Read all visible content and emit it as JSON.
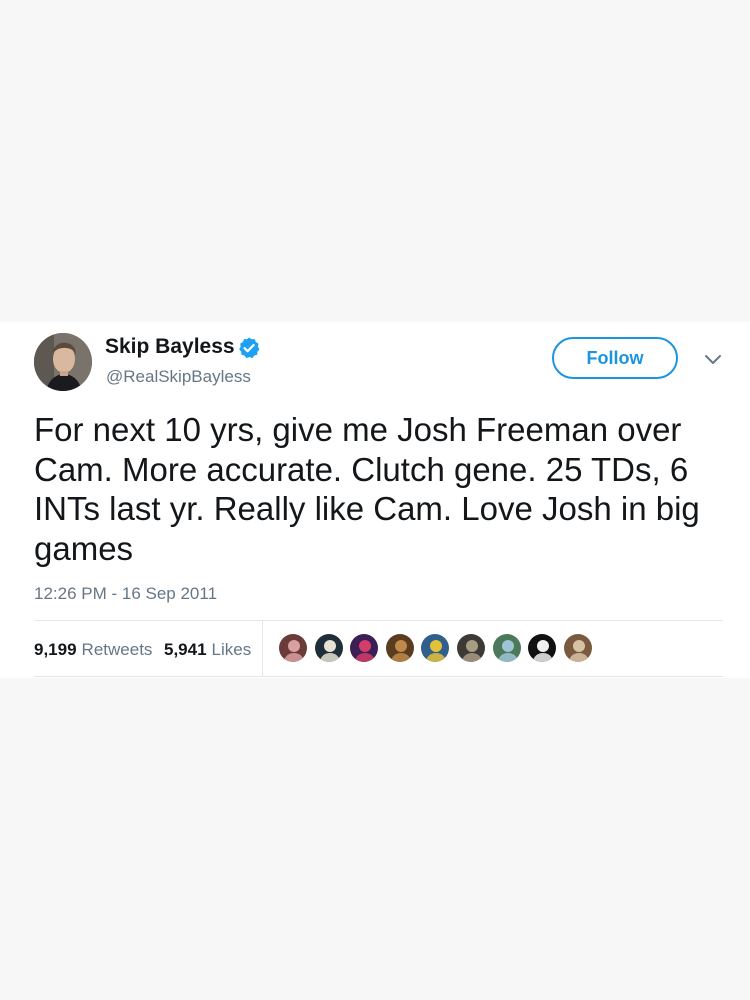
{
  "tweet": {
    "display_name": "Skip Bayless",
    "handle": "@RealSkipBayless",
    "verified": true,
    "follow_label": "Follow",
    "text": "For next 10 yrs, give me Josh Freeman over Cam. More accurate. Clutch gene. 25 TDs, 6 INTs last yr. Really like Cam. Love Josh in big games",
    "timestamp": "12:26 PM - 16 Sep 2011",
    "retweets": {
      "count": "9,199",
      "label": "Retweets"
    },
    "likes": {
      "count": "5,941",
      "label": "Likes"
    },
    "liker_avatars": [
      {
        "icon": "avatar-icon",
        "colors": [
          "#6b3b3b",
          "#d9a0a0"
        ]
      },
      {
        "icon": "avatar-icon",
        "colors": [
          "#1f2f3a",
          "#e8e2d5"
        ]
      },
      {
        "icon": "avatar-icon",
        "colors": [
          "#3b1f55",
          "#d23d6a"
        ]
      },
      {
        "icon": "avatar-icon",
        "colors": [
          "#5a3d1f",
          "#c08a4c"
        ]
      },
      {
        "icon": "avatar-icon",
        "colors": [
          "#2f5f8a",
          "#e3c23a"
        ]
      },
      {
        "icon": "avatar-icon",
        "colors": [
          "#3d3a35",
          "#a89c85"
        ]
      },
      {
        "icon": "avatar-icon",
        "colors": [
          "#4a7a5a",
          "#9fc4d6"
        ]
      },
      {
        "icon": "avatar-icon",
        "colors": [
          "#111111",
          "#f0f0f0"
        ]
      },
      {
        "icon": "avatar-icon",
        "colors": [
          "#7a5a3f",
          "#d8c2a6"
        ]
      }
    ]
  },
  "colors": {
    "accent": "#1b95e0",
    "text_primary": "#14171a",
    "text_secondary": "#657786",
    "divider": "#e1e8ed",
    "page_background": "#f7f7f7",
    "card_background": "#ffffff"
  }
}
